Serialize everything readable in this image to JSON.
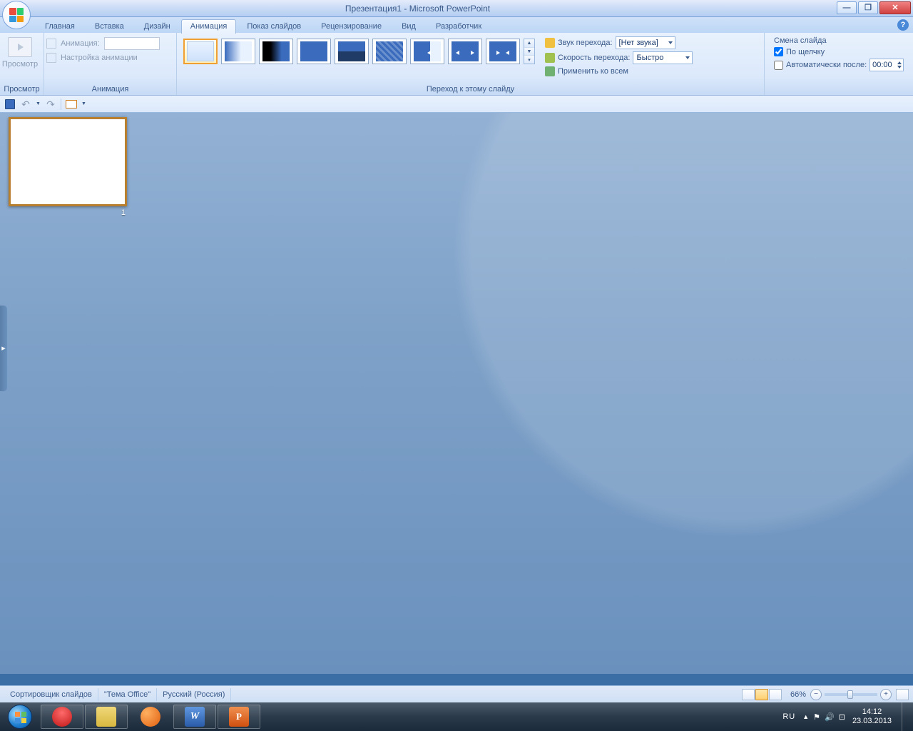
{
  "title": "Презентация1 - Microsoft PowerPoint",
  "tabs": [
    "Главная",
    "Вставка",
    "Дизайн",
    "Анимация",
    "Показ слайдов",
    "Рецензирование",
    "Вид",
    "Разработчик"
  ],
  "activeTab": 3,
  "ribbon": {
    "preview": {
      "label": "Просмотр",
      "group": "Просмотр"
    },
    "animation": {
      "label": "Анимация:",
      "custom": "Настройка анимации",
      "group": "Анимация"
    },
    "transition": {
      "sound_lbl": "Звук перехода:",
      "sound_val": "[Нет звука]",
      "speed_lbl": "Скорость перехода:",
      "speed_val": "Быстро",
      "apply_all": "Применить ко всем",
      "group": "Переход к этому слайду"
    },
    "advance": {
      "title": "Смена слайда",
      "on_click": "По щелчку",
      "auto_after": "Автоматически после:",
      "time": "00:00",
      "on_click_checked": true,
      "auto_checked": false
    }
  },
  "slide_num": "1",
  "status": {
    "view": "Сортировщик слайдов",
    "theme": "\"Тема Office\"",
    "lang": "Русский (Россия)",
    "zoom": "66%"
  },
  "tray": {
    "lang": "RU",
    "time": "14:12",
    "date": "23.03.2013"
  }
}
